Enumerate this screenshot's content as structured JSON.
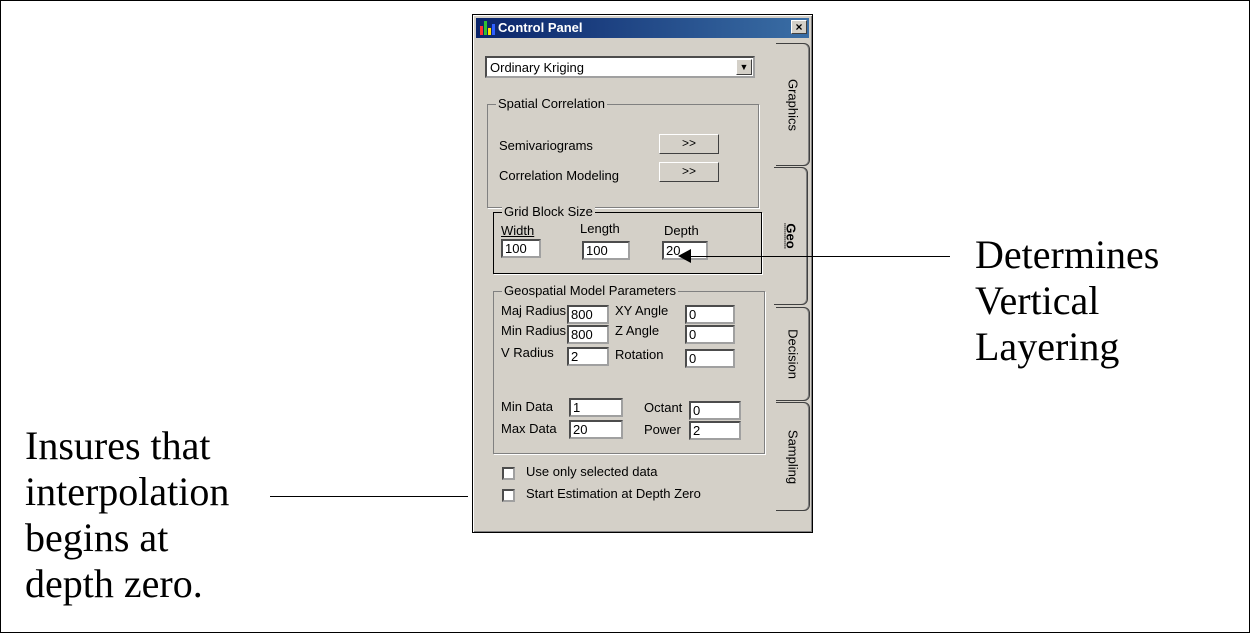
{
  "window": {
    "title": "Control Panel",
    "close_label": "×",
    "accent": "#0a246a"
  },
  "method": {
    "selected": "Ordinary Kriging"
  },
  "spatial_correlation": {
    "legend": "Spatial Correlation",
    "semivariograms_label": "Semivariograms",
    "correlation_modeling_label": "Correlation Modeling",
    "open_button": ">>"
  },
  "grid_block": {
    "legend": "Grid Block Size",
    "width_label": "Width",
    "width_value": "100",
    "length_label": "Length",
    "length_value": "100",
    "depth_label": "Depth",
    "depth_value": "20"
  },
  "geo_params": {
    "legend": "Geospatial Model Parameters",
    "maj_radius_label": "Maj Radius",
    "maj_radius": "800",
    "min_radius_label": "Min Radius",
    "min_radius": "800",
    "v_radius_label": "V Radius",
    "v_radius": "2",
    "xy_angle_label": "XY Angle",
    "xy_angle": "0",
    "z_angle_label": "Z Angle",
    "z_angle": "0",
    "rotation_label": "Rotation",
    "rotation": "0",
    "min_data_label": "Min Data",
    "min_data": "1",
    "max_data_label": "Max Data",
    "max_data": "20",
    "octant_label": "Octant",
    "octant": "0",
    "power_label": "Power",
    "power": "2"
  },
  "options": {
    "use_selected": "Use only selected data",
    "start_depth_zero": "Start Estimation at Depth Zero"
  },
  "tabs": [
    "Graphics",
    "Geo",
    "Decision",
    "Sampling"
  ],
  "annotations": {
    "right": [
      "Determines",
      "Vertical",
      "Layering"
    ],
    "left": [
      "Insures that",
      "interpolation",
      "begins at",
      "depth zero."
    ]
  }
}
